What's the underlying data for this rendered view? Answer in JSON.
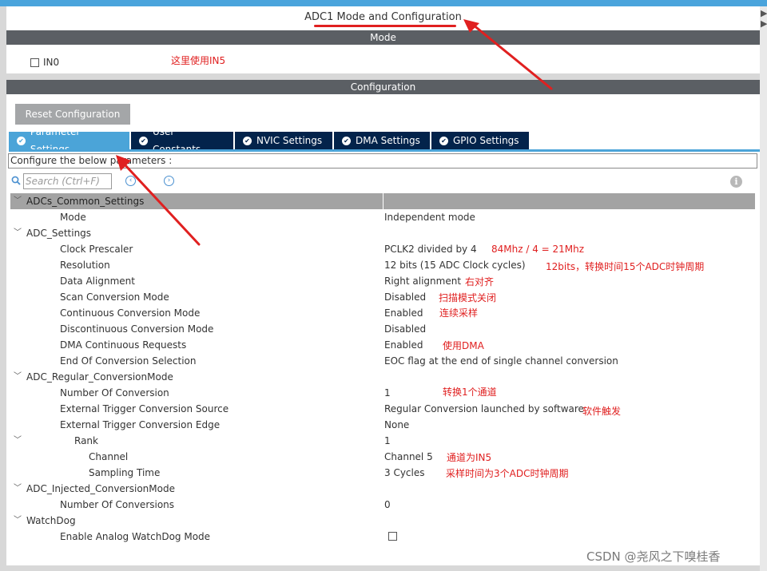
{
  "window": {
    "title": "ADC1 Mode and Configuration"
  },
  "mode_section": {
    "header": "Mode",
    "in0_label": "IN0"
  },
  "config_section": {
    "header": "Configuration",
    "reset_label": "Reset Configuration"
  },
  "tabs": [
    {
      "label": "Parameter Settings",
      "active": true
    },
    {
      "label": "User Constants",
      "active": false
    },
    {
      "label": "NVIC Settings",
      "active": false
    },
    {
      "label": "DMA Settings",
      "active": false
    },
    {
      "label": "GPIO Settings",
      "active": false
    }
  ],
  "hint": "Configure the below parameters :",
  "search": {
    "placeholder": "Search (Ctrl+F)"
  },
  "params": {
    "common_group": "ADCs_Common_Settings",
    "mode_label": "Mode",
    "mode_value": "Independent mode",
    "adc_settings_group": "ADC_Settings",
    "clock_prescaler_label": "Clock Prescaler",
    "clock_prescaler_value": "PCLK2 divided by 4",
    "resolution_label": "Resolution",
    "resolution_value": "12 bits (15 ADC Clock cycles)",
    "data_alignment_label": "Data Alignment",
    "data_alignment_value": "Right alignment",
    "scan_mode_label": "Scan Conversion Mode",
    "scan_mode_value": "Disabled",
    "continuous_label": "Continuous Conversion Mode",
    "continuous_value": "Enabled",
    "discontinuous_label": "Discontinuous Conversion Mode",
    "discontinuous_value": "Disabled",
    "dma_requests_label": "DMA Continuous Requests",
    "dma_requests_value": "Enabled",
    "eoc_label": "End Of Conversion Selection",
    "eoc_value": "EOC flag at the end of single channel conversion",
    "regular_group": "ADC_Regular_ConversionMode",
    "num_conversion_label": "Number Of Conversion",
    "num_conversion_value": "1",
    "ext_trigger_source_label": "External Trigger Conversion Source",
    "ext_trigger_source_value": "Regular Conversion launched by software",
    "ext_trigger_edge_label": "External Trigger Conversion Edge",
    "ext_trigger_edge_value": "None",
    "rank_label": "Rank",
    "rank_value": "1",
    "channel_label": "Channel",
    "channel_value": "Channel 5",
    "sampling_label": "Sampling Time",
    "sampling_value": "3 Cycles",
    "injected_group": "ADC_Injected_ConversionMode",
    "num_conversions_label": "Number Of Conversions",
    "num_conversions_value": "0",
    "watchdog_group": "WatchDog",
    "watchdog_label": "Enable Analog WatchDog Mode"
  },
  "annotations": {
    "in5_note": "这里使用IN5",
    "clock_note": "84Mhz / 4 = 21Mhz",
    "resolution_note": "12bits，转换时间15个ADC时钟周期",
    "alignment_note": "右对齐",
    "scan_note": "扫描模式关闭",
    "continuous_note": "连续采样",
    "dma_note": "使用DMA",
    "num_conv_note": "转换1个通道",
    "trigger_note": "软件触发",
    "channel_note": "通道为IN5",
    "sampling_note": "采样时间为3个ADC时钟周期"
  },
  "watermark": "CSDN @尧风之下嗅桂香",
  "colors": {
    "accent": "#4ba4d8",
    "tab_dark": "#03234b",
    "annotation": "#e02020",
    "header_bar": "#5b5f64"
  }
}
